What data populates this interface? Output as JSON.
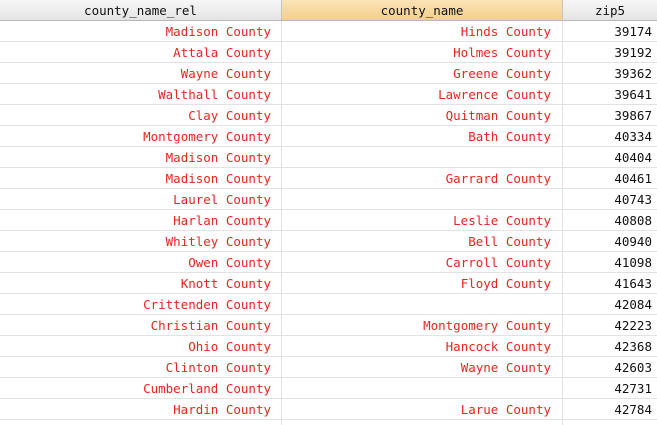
{
  "columns": [
    "county_name_rel",
    "county_name",
    "zip5"
  ],
  "rows": [
    [
      "Madison County",
      "Hinds County",
      "39174"
    ],
    [
      "Attala County",
      "Holmes County",
      "39192"
    ],
    [
      "Wayne County",
      "Greene County",
      "39362"
    ],
    [
      "Walthall County",
      "Lawrence County",
      "39641"
    ],
    [
      "Clay County",
      "Quitman County",
      "39867"
    ],
    [
      "Montgomery County",
      "Bath County",
      "40334"
    ],
    [
      "Madison County",
      "",
      "40404"
    ],
    [
      "Madison County",
      "Garrard County",
      "40461"
    ],
    [
      "Laurel County",
      "",
      "40743"
    ],
    [
      "Harlan County",
      "Leslie County",
      "40808"
    ],
    [
      "Whitley County",
      "Bell County",
      "40940"
    ],
    [
      "Owen County",
      "Carroll County",
      "41098"
    ],
    [
      "Knott County",
      "Floyd County",
      "41643"
    ],
    [
      "Crittenden County",
      "",
      "42084"
    ],
    [
      "Christian County",
      "Montgomery County",
      "42223"
    ],
    [
      "Ohio County",
      "Hancock County",
      "42368"
    ],
    [
      "Clinton County",
      "Wayne County",
      "42603"
    ],
    [
      "Cumberland County",
      "",
      "42731"
    ],
    [
      "Hardin County",
      "Larue County",
      "42784"
    ],
    [
      "",
      "",
      ""
    ]
  ],
  "colors": {
    "text_value": "#e8251f",
    "text_default": "#111111",
    "sorted_header": "#f3cf8a"
  }
}
